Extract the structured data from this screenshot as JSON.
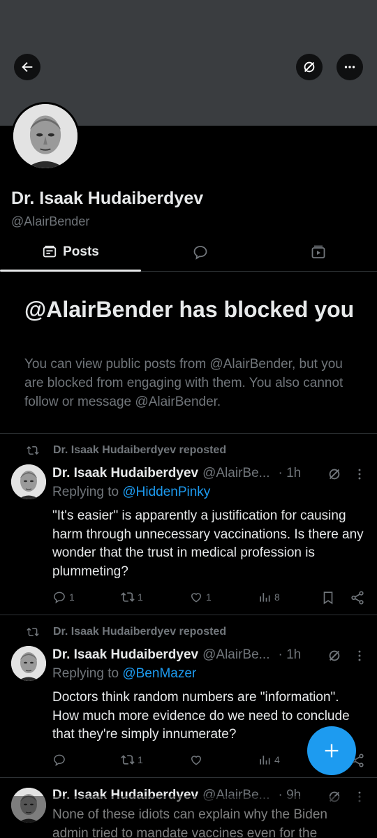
{
  "profile": {
    "name": "Dr. Isaak Hudaiberdyev",
    "handle": "@AlairBender"
  },
  "header_icons": [
    "back-arrow-icon",
    "grok-icon",
    "more-icon"
  ],
  "tabs": [
    {
      "label": "Posts",
      "icon": "posts-icon",
      "active": true
    },
    {
      "label": "",
      "icon": "replies-icon",
      "active": false
    },
    {
      "label": "",
      "icon": "media-icon",
      "active": false
    }
  ],
  "blocked": {
    "title": "@AlairBender has blocked you",
    "description": "You can view public posts from @AlairBender, but you are blocked from engaging with them. You also cannot follow or message @AlairBender."
  },
  "posts": [
    {
      "repost_label": "Dr. Isaak Hudaiberdyev reposted",
      "name": "Dr. Isaak Hudaiberdyev",
      "handle": "@AlairBe...",
      "time": "· 1h",
      "replying_prefix": "Replying to",
      "replying_to": "@HiddenPinky",
      "text": "\"It's easier\" is apparently a justification for causing harm through unnecessary vaccinations. Is there any wonder that the trust in medical profession is plummeting?",
      "replies": "1",
      "reposts": "1",
      "likes": "1",
      "views": "8"
    },
    {
      "repost_label": "Dr. Isaak Hudaiberdyev reposted",
      "name": "Dr. Isaak Hudaiberdyev",
      "handle": "@AlairBe...",
      "time": "· 1h",
      "replying_prefix": "Replying to",
      "replying_to": "@BenMazer",
      "text": "Doctors think random numbers are \"information\". How much more evidence do we need to conclude that they're simply innumerate?",
      "replies": "",
      "reposts": "1",
      "likes": "",
      "views": "4"
    },
    {
      "name": "Dr. Isaak Hudaiberdyev",
      "handle": "@AlairBe...",
      "time": "· 9h",
      "text": "None of these idiots can explain why the Biden admin tried to mandate vaccines even for the"
    }
  ],
  "colors": {
    "background": "#000000",
    "banner": "#3a3d40",
    "text": "#e7e9ea",
    "muted": "#71767b",
    "accent": "#1d9bf0",
    "divider": "#2f3336"
  }
}
